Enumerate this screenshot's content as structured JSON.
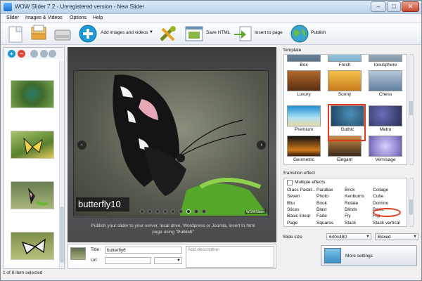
{
  "window": {
    "title": "WOW Slider 7.2 - Unregistered version - New Slider",
    "min": "–",
    "max": "□",
    "close": "✕"
  },
  "menu": [
    "Slider",
    "Images & Videos",
    "Options",
    "Help"
  ],
  "toolbar": {
    "add_label": "Add images and videos",
    "save_html": "Save HTML",
    "insert": "Insert to page",
    "publish": "Publish"
  },
  "left": {
    "status": "1 of 8 item selected",
    "add_icon": "+",
    "remove_icon": "−"
  },
  "slide": {
    "caption": "butterfly10",
    "watermark": "WOWSlider",
    "prev": "‹",
    "next": "›",
    "dots_total": 9,
    "dots_active": 7,
    "hint_line1": "Publish your slider to your server, local drive, Wordpress or Joomla, insert to html",
    "hint_line2": "page using",
    "hint_bold": "\"Publish\""
  },
  "props": {
    "title_label": "Title:",
    "title_value": "butterfly6",
    "url_label": "Url:",
    "url_value": "",
    "desc_placeholder": "Add description"
  },
  "template": {
    "label": "Template",
    "items": [
      "Box",
      "Fresh",
      "Ionosphere",
      "Luxury",
      "Gothic",
      "Chess",
      "Premium",
      "",
      "Metro",
      "Geometric",
      "Elegant",
      "Vernisage"
    ],
    "selected": "Gothic",
    "luxury_sub": "Sunny"
  },
  "effects": {
    "label": "Transition effect",
    "multiple": "Multiple effects",
    "columns": [
      [
        "Glass Parall...",
        "Seven",
        "Blur",
        "Slices",
        "Basic linear",
        "Page"
      ],
      [
        "Parallax",
        "Photo",
        "Book",
        "Blast",
        "Fade",
        "Squares"
      ],
      [
        "Brick",
        "Kenburns",
        "Rotate",
        "Blinds",
        "Fly",
        "Stack"
      ],
      [
        "Collage",
        "Cube",
        "Domino",
        "Basic",
        "Flip",
        "Stack vertical"
      ]
    ],
    "selected": "Domino"
  },
  "slide_size": {
    "label": "Slide size",
    "value": "640x480",
    "mode": "Boxed"
  },
  "more_settings": "More settings",
  "colors": {
    "accent": "#e23a1a",
    "add": "#1d9bd6",
    "remove": "#e0463a"
  }
}
